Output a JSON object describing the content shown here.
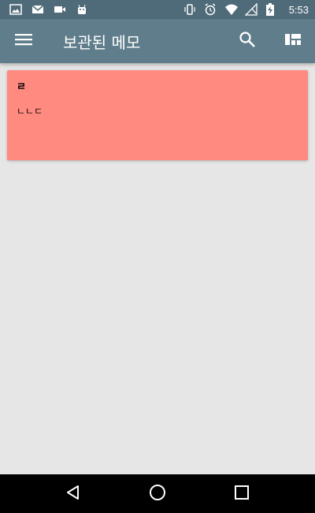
{
  "status_bar": {
    "time": "5:53",
    "left_icons": [
      "image-icon",
      "gmail-icon",
      "video-icon",
      "android-icon"
    ],
    "right_icons": [
      "vibrate-icon",
      "alarm-icon",
      "wifi-icon",
      "no-signal-icon",
      "battery-charging-icon"
    ]
  },
  "app_bar": {
    "title": "보관된 메모",
    "menu_icon": "menu-icon",
    "search_icon": "search-icon",
    "layout_icon": "layout-icon"
  },
  "notes": [
    {
      "title": "ㄹ",
      "body": "ㄴㄴㄷ",
      "color": "#ff8a80"
    }
  ],
  "nav_bar": {
    "icons": [
      "back-icon",
      "home-icon",
      "recents-icon"
    ]
  },
  "colors": {
    "status_bar": "#4f6a78",
    "app_bar": "#607d8b",
    "background": "#e6e6e6",
    "nav_bar": "#000000"
  }
}
